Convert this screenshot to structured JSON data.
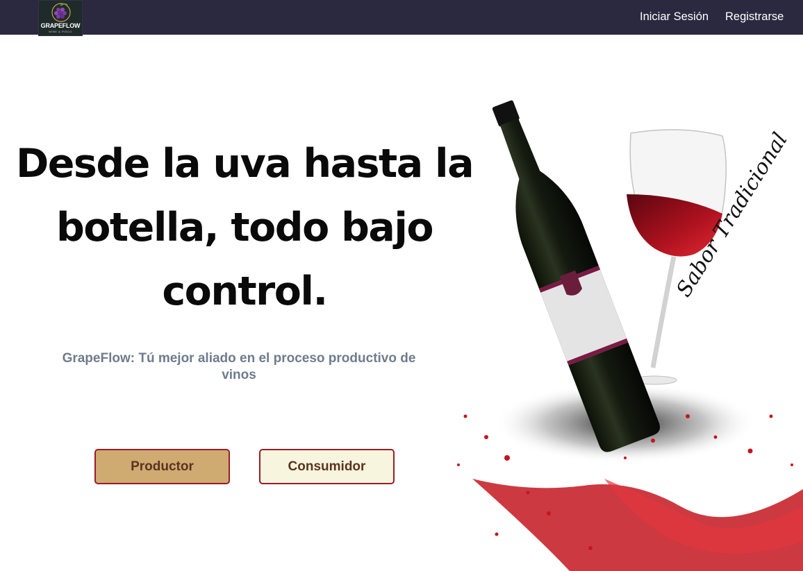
{
  "header": {
    "logo": {
      "name": "GRAPEFLOW",
      "tagline": "WINE & PISCO",
      "icon": "grape-icon"
    },
    "nav": {
      "login_label": "Iniciar Sesión",
      "register_label": "Registrarse"
    }
  },
  "hero": {
    "title": "Desde la uva hasta la botella, todo bajo control.",
    "subtitle": "GrapeFlow: Tú mejor aliado en el proceso productivo de vinos",
    "buttons": {
      "producer_label": "Productor",
      "consumer_label": "Consumidor"
    },
    "image": {
      "script_text": "Sabor Tradicional",
      "subjects": [
        "wine-bottle",
        "wine-glass",
        "wine-splash"
      ]
    }
  },
  "colors": {
    "navbar": "#2b2940",
    "producer_button": "#cfab72",
    "consumer_button": "#f8f5de",
    "button_border": "#9b1b2a",
    "wine": "#a3101e"
  }
}
